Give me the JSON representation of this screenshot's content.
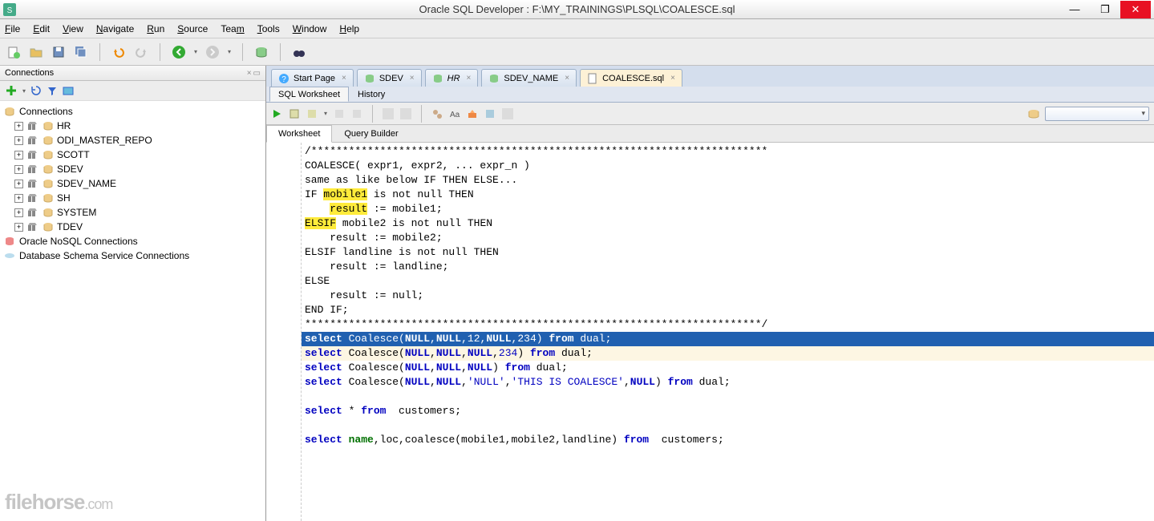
{
  "title": "Oracle SQL Developer : F:\\MY_TRAININGS\\PLSQL\\COALESCE.sql",
  "menu": [
    "File",
    "Edit",
    "View",
    "Navigate",
    "Run",
    "Source",
    "Team",
    "Tools",
    "Window",
    "Help"
  ],
  "connections_panel": {
    "title": "Connections",
    "root": "Connections",
    "items": [
      "HR",
      "ODI_MASTER_REPO",
      "SCOTT",
      "SDEV",
      "SDEV_NAME",
      "SH",
      "SYSTEM",
      "TDEV"
    ],
    "extra": [
      "Oracle NoSQL Connections",
      "Database Schema Service Connections"
    ]
  },
  "file_tabs": [
    {
      "label": "Start Page",
      "icon": "info"
    },
    {
      "label": "SDEV",
      "icon": "sql"
    },
    {
      "label": "HR",
      "icon": "sql",
      "italic": true
    },
    {
      "label": "SDEV_NAME",
      "icon": "sql"
    },
    {
      "label": "COALESCE.sql",
      "icon": "file",
      "active": true
    }
  ],
  "sub_tabs": [
    "SQL Worksheet",
    "History"
  ],
  "ws_tabs": [
    "Worksheet",
    "Query Builder"
  ],
  "code_lines": [
    {
      "type": "comment",
      "text": "/*************************************************************************"
    },
    {
      "type": "plain",
      "text": "COALESCE( expr1, expr2, ... expr_n )"
    },
    {
      "type": "plain",
      "text": "same as like below IF THEN ELSE..."
    },
    {
      "type": "hl",
      "pre": "IF ",
      "hl": "mobile1",
      "post": " is not null THEN"
    },
    {
      "type": "hl",
      "pre": "    ",
      "hl": "result",
      " post": " := mobile1;"
    },
    {
      "type": "hl",
      "pre": "",
      "hl": "ELSIF",
      "post": " mobile2 is not null THEN"
    },
    {
      "type": "plain",
      "text": "    result := mobile2;"
    },
    {
      "type": "plain",
      "text": "ELSIF landline is not null THEN"
    },
    {
      "type": "plain",
      "text": "    result := landline;"
    },
    {
      "type": "plain",
      "text": "ELSE"
    },
    {
      "type": "plain",
      "text": "    result := null;"
    },
    {
      "type": "plain",
      "text": "END IF;"
    },
    {
      "type": "comment",
      "text": "*************************************************************************/"
    },
    {
      "type": "sql_sel",
      "text": "select Coalesce(NULL,NULL,12,NULL,234) from dual;"
    },
    {
      "type": "sql_cur",
      "text": "select Coalesce(NULL,NULL,NULL,234) from dual;"
    },
    {
      "type": "sql",
      "text": "select Coalesce(NULL,NULL,NULL) from dual;"
    },
    {
      "type": "sql2",
      "text": "select Coalesce(NULL,NULL,'NULL','THIS IS COALESCE',NULL) from dual;"
    },
    {
      "type": "blank",
      "text": ""
    },
    {
      "type": "sql3",
      "text": "select * from  customers;"
    },
    {
      "type": "blank",
      "text": ""
    },
    {
      "type": "sql4",
      "text": "select name,loc,coalesce(mobile1,mobile2,landline) from  customers;"
    }
  ],
  "watermark": "filehorse",
  "watermark_suffix": ".com"
}
